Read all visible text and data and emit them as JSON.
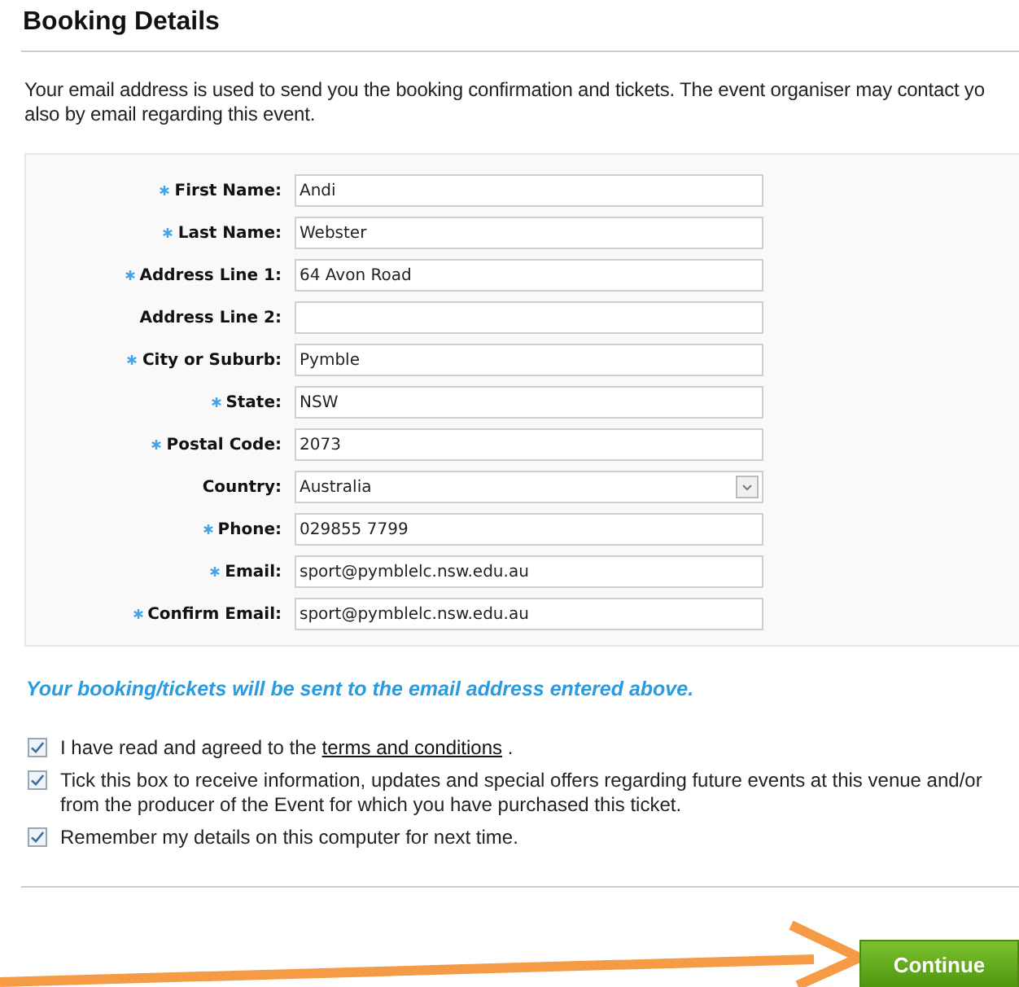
{
  "title": "Booking Details",
  "intro_lines": [
    "Your email address is used to send you the booking confirmation and tickets. The event organiser may contact yo",
    "also by email regarding this event."
  ],
  "fields": [
    {
      "kind": "text",
      "label": "First Name:",
      "required": true,
      "value": "Andi"
    },
    {
      "kind": "text",
      "label": "Last Name:",
      "required": true,
      "value": "Webster"
    },
    {
      "kind": "text",
      "label": "Address Line 1:",
      "required": true,
      "value": "64 Avon Road"
    },
    {
      "kind": "text",
      "label": "Address Line 2:",
      "required": false
    },
    {
      "kind": "text",
      "label": "City or Suburb:",
      "required": true,
      "value": "Pymble"
    },
    {
      "kind": "text",
      "label": "State:",
      "required": true,
      "value": "NSW"
    },
    {
      "kind": "text",
      "label": "Postal Code:",
      "required": true,
      "value": "2073"
    },
    {
      "kind": "select",
      "label": "Country:",
      "required": false,
      "value": "Australia"
    },
    {
      "kind": "text",
      "label": "Phone:",
      "required": true,
      "value": "029855 7799"
    },
    {
      "kind": "text",
      "label": "Email:",
      "required": true,
      "value": "sport@pymblelc.nsw.edu.au"
    },
    {
      "kind": "text",
      "label": "Confirm Email:",
      "required": true,
      "value": "sport@pymblelc.nsw.edu.au"
    }
  ],
  "note": "Your booking/tickets will be sent to the email address entered above.",
  "options": [
    {
      "checked": true,
      "text": "I have read and agreed to the",
      "link": "terms and conditions",
      "after": "."
    },
    {
      "checked": true,
      "text": "Tick this box to receive information, updates and special offers regarding future events at this venue and/or from the producer of the Event for which you have purchased this ticket."
    },
    {
      "checked": true,
      "text": "Remember my details on this computer for next time."
    }
  ],
  "continue_button": "Continue"
}
